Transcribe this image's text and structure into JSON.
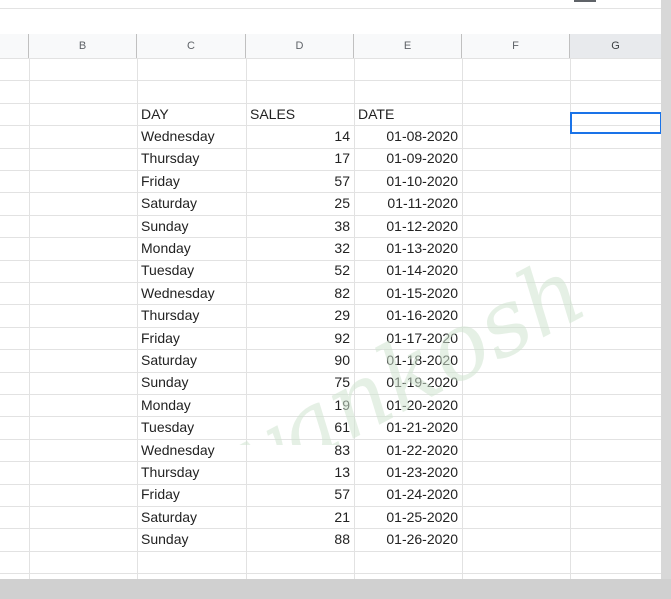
{
  "sheet": {
    "columns": [
      "B",
      "C",
      "D",
      "E",
      "F",
      "G"
    ],
    "selected_column": "G",
    "headers": {
      "day": "DAY",
      "sales": "SALES",
      "date": "DATE"
    },
    "rows": [
      {
        "day": "Wednesday",
        "sales": "14",
        "date": "01-08-2020"
      },
      {
        "day": "Thursday",
        "sales": "17",
        "date": "01-09-2020"
      },
      {
        "day": "Friday",
        "sales": "57",
        "date": "01-10-2020"
      },
      {
        "day": "Saturday",
        "sales": "25",
        "date": "01-11-2020"
      },
      {
        "day": "Sunday",
        "sales": "38",
        "date": "01-12-2020"
      },
      {
        "day": "Monday",
        "sales": "32",
        "date": "01-13-2020"
      },
      {
        "day": "Tuesday",
        "sales": "52",
        "date": "01-14-2020"
      },
      {
        "day": "Wednesday",
        "sales": "82",
        "date": "01-15-2020"
      },
      {
        "day": "Thursday",
        "sales": "29",
        "date": "01-16-2020"
      },
      {
        "day": "Friday",
        "sales": "92",
        "date": "01-17-2020"
      },
      {
        "day": "Saturday",
        "sales": "90",
        "date": "01-18-2020"
      },
      {
        "day": "Sunday",
        "sales": "75",
        "date": "01-19-2020"
      },
      {
        "day": "Monday",
        "sales": "19",
        "date": "01-20-2020"
      },
      {
        "day": "Tuesday",
        "sales": "61",
        "date": "01-21-2020"
      },
      {
        "day": "Wednesday",
        "sales": "83",
        "date": "01-22-2020"
      },
      {
        "day": "Thursday",
        "sales": "13",
        "date": "01-23-2020"
      },
      {
        "day": "Friday",
        "sales": "57",
        "date": "01-24-2020"
      },
      {
        "day": "Saturday",
        "sales": "21",
        "date": "01-25-2020"
      },
      {
        "day": "Sunday",
        "sales": "88",
        "date": "01-26-2020"
      }
    ]
  },
  "watermark": "gyankosh.net",
  "colors": {
    "selection": "#1a73e8",
    "watermark": "#cfe3cf"
  }
}
